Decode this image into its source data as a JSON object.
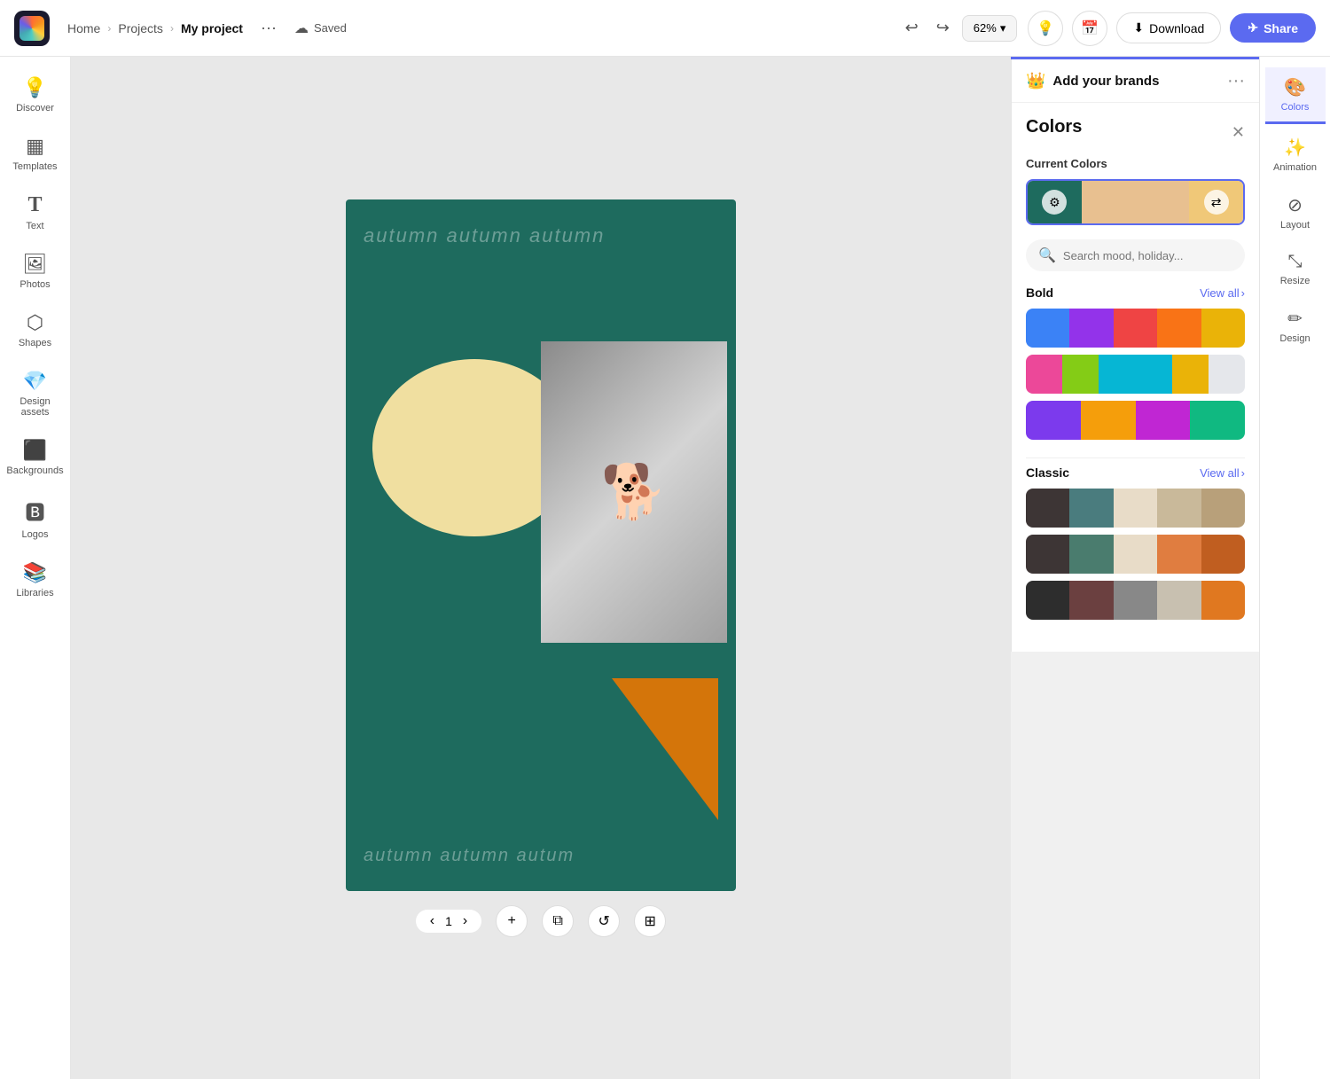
{
  "topbar": {
    "logo_alt": "Logoipsum",
    "breadcrumb": {
      "home": "Home",
      "projects": "Projects",
      "current": "My project"
    },
    "saved_label": "Saved",
    "zoom_level": "62%",
    "download_label": "Download",
    "share_label": "Share"
  },
  "left_sidebar": {
    "items": [
      {
        "id": "discover",
        "label": "Discover",
        "icon": "💡"
      },
      {
        "id": "templates",
        "label": "Templates",
        "icon": "🖼"
      },
      {
        "id": "text",
        "label": "Text",
        "icon": "T"
      },
      {
        "id": "photos",
        "label": "Photos",
        "icon": "🖼"
      },
      {
        "id": "shapes",
        "label": "Shapes",
        "icon": "⚙"
      },
      {
        "id": "design-assets",
        "label": "Design assets",
        "icon": "💎"
      },
      {
        "id": "backgrounds",
        "label": "Backgrounds",
        "icon": "🔲"
      },
      {
        "id": "logos",
        "label": "Logos",
        "icon": "🅱"
      },
      {
        "id": "libraries",
        "label": "Libraries",
        "icon": "📚"
      }
    ]
  },
  "canvas": {
    "text_top": "autumn autumn autumn",
    "text_bottom": "autumn autumn autum",
    "page_number": "1"
  },
  "colors_panel": {
    "brand_label": "Add your brands",
    "section_title": "Colors",
    "current_colors_label": "Current Colors",
    "search_placeholder": "Search mood, holiday...",
    "current_palette": [
      {
        "color": "#1e6b5e"
      },
      {
        "color": "#e8a87c"
      },
      {
        "color": "#e8a87c"
      },
      {
        "color": "#e8a87c"
      }
    ],
    "bold_label": "Bold",
    "bold_view_all": "View all",
    "bold_palettes": [
      [
        {
          "color": "#3b82f6"
        },
        {
          "color": "#9333ea"
        },
        {
          "color": "#ef4444"
        },
        {
          "color": "#f97316"
        },
        {
          "color": "#eab308"
        }
      ],
      [
        {
          "color": "#ec4899"
        },
        {
          "color": "#84cc16"
        },
        {
          "color": "#06b6d4"
        },
        {
          "color": "#06b6d4"
        },
        {
          "color": "#eab308"
        },
        {
          "color": "#e5e7eb"
        }
      ],
      [
        {
          "color": "#7c3aed"
        },
        {
          "color": "#f59e0b"
        },
        {
          "color": "#c026d3"
        },
        {
          "color": "#10b981"
        }
      ]
    ],
    "classic_label": "Classic",
    "classic_view_all": "View all",
    "classic_palettes": [
      [
        {
          "color": "#3d3535"
        },
        {
          "color": "#4a7c7e"
        },
        {
          "color": "#e8dcc8"
        },
        {
          "color": "#c9b99a"
        },
        {
          "color": "#b8a07a"
        }
      ],
      [
        {
          "color": "#3d3535"
        },
        {
          "color": "#4a7c6e"
        },
        {
          "color": "#e8dcc8"
        },
        {
          "color": "#e07d40"
        },
        {
          "color": "#c05e20"
        }
      ],
      [
        {
          "color": "#2d2d2d"
        },
        {
          "color": "#6b4040"
        },
        {
          "color": "#888888"
        },
        {
          "color": "#c8c0b0"
        },
        {
          "color": "#e07820"
        }
      ]
    ]
  },
  "right_icon_panel": {
    "items": [
      {
        "id": "colors",
        "label": "Colors",
        "icon": "🎨",
        "active": true
      },
      {
        "id": "animation",
        "label": "Animation",
        "icon": "✨"
      },
      {
        "id": "layout",
        "label": "Layout",
        "icon": "⊘"
      },
      {
        "id": "resize",
        "label": "Resize",
        "icon": "⤡"
      },
      {
        "id": "design",
        "label": "Design",
        "icon": "✏"
      }
    ]
  }
}
